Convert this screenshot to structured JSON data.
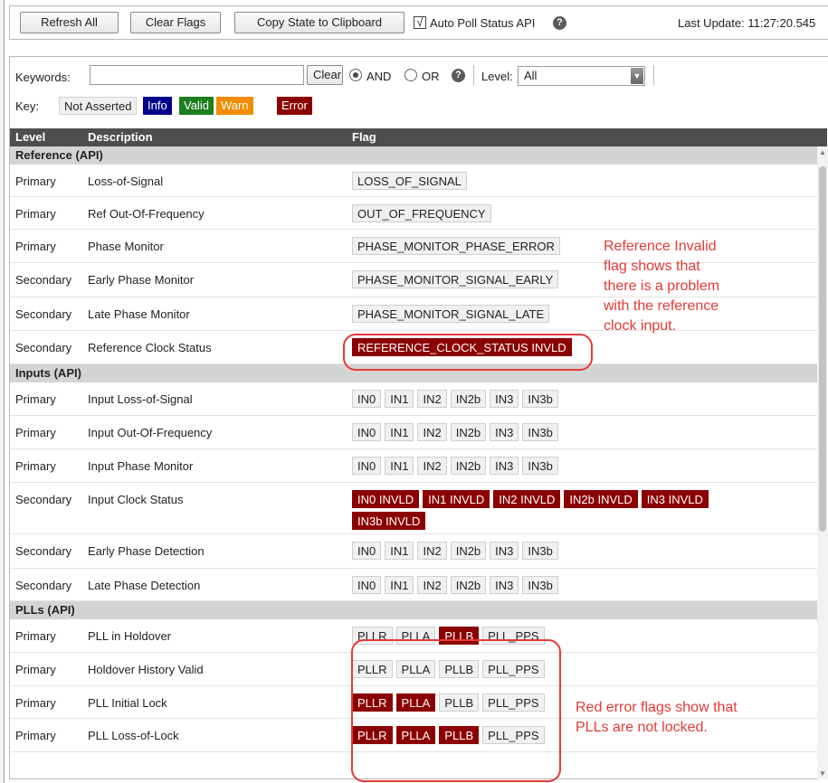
{
  "toolbar": {
    "refresh_label": "Refresh All",
    "clear_flags_label": "Clear Flags",
    "copy_state_label": "Copy State to Clipboard",
    "auto_poll_label": "Auto Poll Status API",
    "auto_poll_checked": "√",
    "last_update": "Last Update: 11:27:20.545"
  },
  "filter": {
    "keywords_label": "Keywords:",
    "keywords_value": "",
    "clear_label": "Clear",
    "and_label": "AND",
    "or_label": "OR",
    "level_label": "Level:",
    "level_value": "All",
    "help_glyph": "?"
  },
  "key": {
    "label": "Key:",
    "items": [
      {
        "text": "Not Asserted",
        "bg": "#f0f0f0",
        "fg": "#222222"
      },
      {
        "text": "Info",
        "bg": "#00008b",
        "fg": "#ffffff"
      },
      {
        "text": "Valid",
        "bg": "#1e7d1e",
        "fg": "#ffffff"
      },
      {
        "text": "Warn",
        "bg": "#f28c00",
        "fg": "#ffffff"
      },
      {
        "text": "Error",
        "bg": "#8b0000",
        "fg": "#ffffff"
      }
    ]
  },
  "table": {
    "headers": {
      "level": "Level",
      "description": "Description",
      "flag": "Flag"
    },
    "groups": [
      {
        "title": "Reference (API)",
        "rows": [
          {
            "level": "Primary",
            "description": "Loss-of-Signal",
            "flags": [
              {
                "t": "LOSS_OF_SIGNAL",
                "e": false
              }
            ]
          },
          {
            "level": "Primary",
            "description": "Ref Out-Of-Frequency",
            "flags": [
              {
                "t": "OUT_OF_FREQUENCY",
                "e": false
              }
            ]
          },
          {
            "level": "Primary",
            "description": "Phase Monitor",
            "flags": [
              {
                "t": "PHASE_MONITOR_PHASE_ERROR",
                "e": false
              }
            ]
          },
          {
            "level": "Secondary",
            "description": "Early Phase Monitor",
            "flags": [
              {
                "t": "PHASE_MONITOR_SIGNAL_EARLY",
                "e": false
              }
            ]
          },
          {
            "level": "Secondary",
            "description": "Late Phase Monitor",
            "flags": [
              {
                "t": "PHASE_MONITOR_SIGNAL_LATE",
                "e": false
              }
            ]
          },
          {
            "level": "Secondary",
            "description": "Reference Clock Status",
            "flags": [
              {
                "t": "REFERENCE_CLOCK_STATUS INVLD",
                "e": true
              }
            ]
          }
        ]
      },
      {
        "title": "Inputs (API)",
        "rows": [
          {
            "level": "Primary",
            "description": "Input Loss-of-Signal",
            "flags": [
              {
                "t": "IN0",
                "e": false
              },
              {
                "t": "IN1",
                "e": false
              },
              {
                "t": "IN2",
                "e": false
              },
              {
                "t": "IN2b",
                "e": false
              },
              {
                "t": "IN3",
                "e": false
              },
              {
                "t": "IN3b",
                "e": false
              }
            ]
          },
          {
            "level": "Primary",
            "description": "Input Out-Of-Frequency",
            "flags": [
              {
                "t": "IN0",
                "e": false
              },
              {
                "t": "IN1",
                "e": false
              },
              {
                "t": "IN2",
                "e": false
              },
              {
                "t": "IN2b",
                "e": false
              },
              {
                "t": "IN3",
                "e": false
              },
              {
                "t": "IN3b",
                "e": false
              }
            ]
          },
          {
            "level": "Primary",
            "description": "Input Phase Monitor",
            "flags": [
              {
                "t": "IN0",
                "e": false
              },
              {
                "t": "IN1",
                "e": false
              },
              {
                "t": "IN2",
                "e": false
              },
              {
                "t": "IN2b",
                "e": false
              },
              {
                "t": "IN3",
                "e": false
              },
              {
                "t": "IN3b",
                "e": false
              }
            ]
          },
          {
            "level": "Secondary",
            "description": "Input Clock Status",
            "flags": [
              {
                "t": "IN0 INVLD",
                "e": true
              },
              {
                "t": "IN1 INVLD",
                "e": true
              },
              {
                "t": "IN2 INVLD",
                "e": true
              },
              {
                "t": "IN2b INVLD",
                "e": true
              },
              {
                "t": "IN3 INVLD",
                "e": true
              },
              {
                "t": "IN3b INVLD",
                "e": true
              }
            ]
          },
          {
            "level": "Secondary",
            "description": "Early Phase Detection",
            "flags": [
              {
                "t": "IN0",
                "e": false
              },
              {
                "t": "IN1",
                "e": false
              },
              {
                "t": "IN2",
                "e": false
              },
              {
                "t": "IN2b",
                "e": false
              },
              {
                "t": "IN3",
                "e": false
              },
              {
                "t": "IN3b",
                "e": false
              }
            ]
          },
          {
            "level": "Secondary",
            "description": "Late Phase Detection",
            "flags": [
              {
                "t": "IN0",
                "e": false
              },
              {
                "t": "IN1",
                "e": false
              },
              {
                "t": "IN2",
                "e": false
              },
              {
                "t": "IN2b",
                "e": false
              },
              {
                "t": "IN3",
                "e": false
              },
              {
                "t": "IN3b",
                "e": false
              }
            ]
          }
        ]
      },
      {
        "title": "PLLs (API)",
        "rows": [
          {
            "level": "Primary",
            "description": "PLL in Holdover",
            "flags": [
              {
                "t": "PLLR",
                "e": false
              },
              {
                "t": "PLLA",
                "e": false
              },
              {
                "t": "PLLB",
                "e": true
              },
              {
                "t": "PLL_PPS",
                "e": false
              }
            ]
          },
          {
            "level": "Primary",
            "description": "Holdover History Valid",
            "flags": [
              {
                "t": "PLLR",
                "e": false
              },
              {
                "t": "PLLA",
                "e": false
              },
              {
                "t": "PLLB",
                "e": false
              },
              {
                "t": "PLL_PPS",
                "e": false
              }
            ]
          },
          {
            "level": "Primary",
            "description": "PLL Initial Lock",
            "flags": [
              {
                "t": "PLLR",
                "e": true
              },
              {
                "t": "PLLA",
                "e": true
              },
              {
                "t": "PLLB",
                "e": false
              },
              {
                "t": "PLL_PPS",
                "e": false
              }
            ]
          },
          {
            "level": "Primary",
            "description": "PLL Loss-of-Lock",
            "flags": [
              {
                "t": "PLLR",
                "e": true
              },
              {
                "t": "PLLA",
                "e": true
              },
              {
                "t": "PLLB",
                "e": true
              },
              {
                "t": "PLL_PPS",
                "e": false
              }
            ]
          }
        ]
      }
    ]
  },
  "annotations": {
    "reference_note": [
      "Reference Invalid",
      "flag shows that",
      "there is a problem",
      "with the reference",
      "clock input."
    ],
    "pll_note": [
      "Red error flags show that",
      "PLLs are not locked."
    ],
    "color": "#e53935"
  },
  "colors": {
    "error": "#8b0000",
    "header": "#4e4e4e",
    "group": "#d4d4d4"
  }
}
